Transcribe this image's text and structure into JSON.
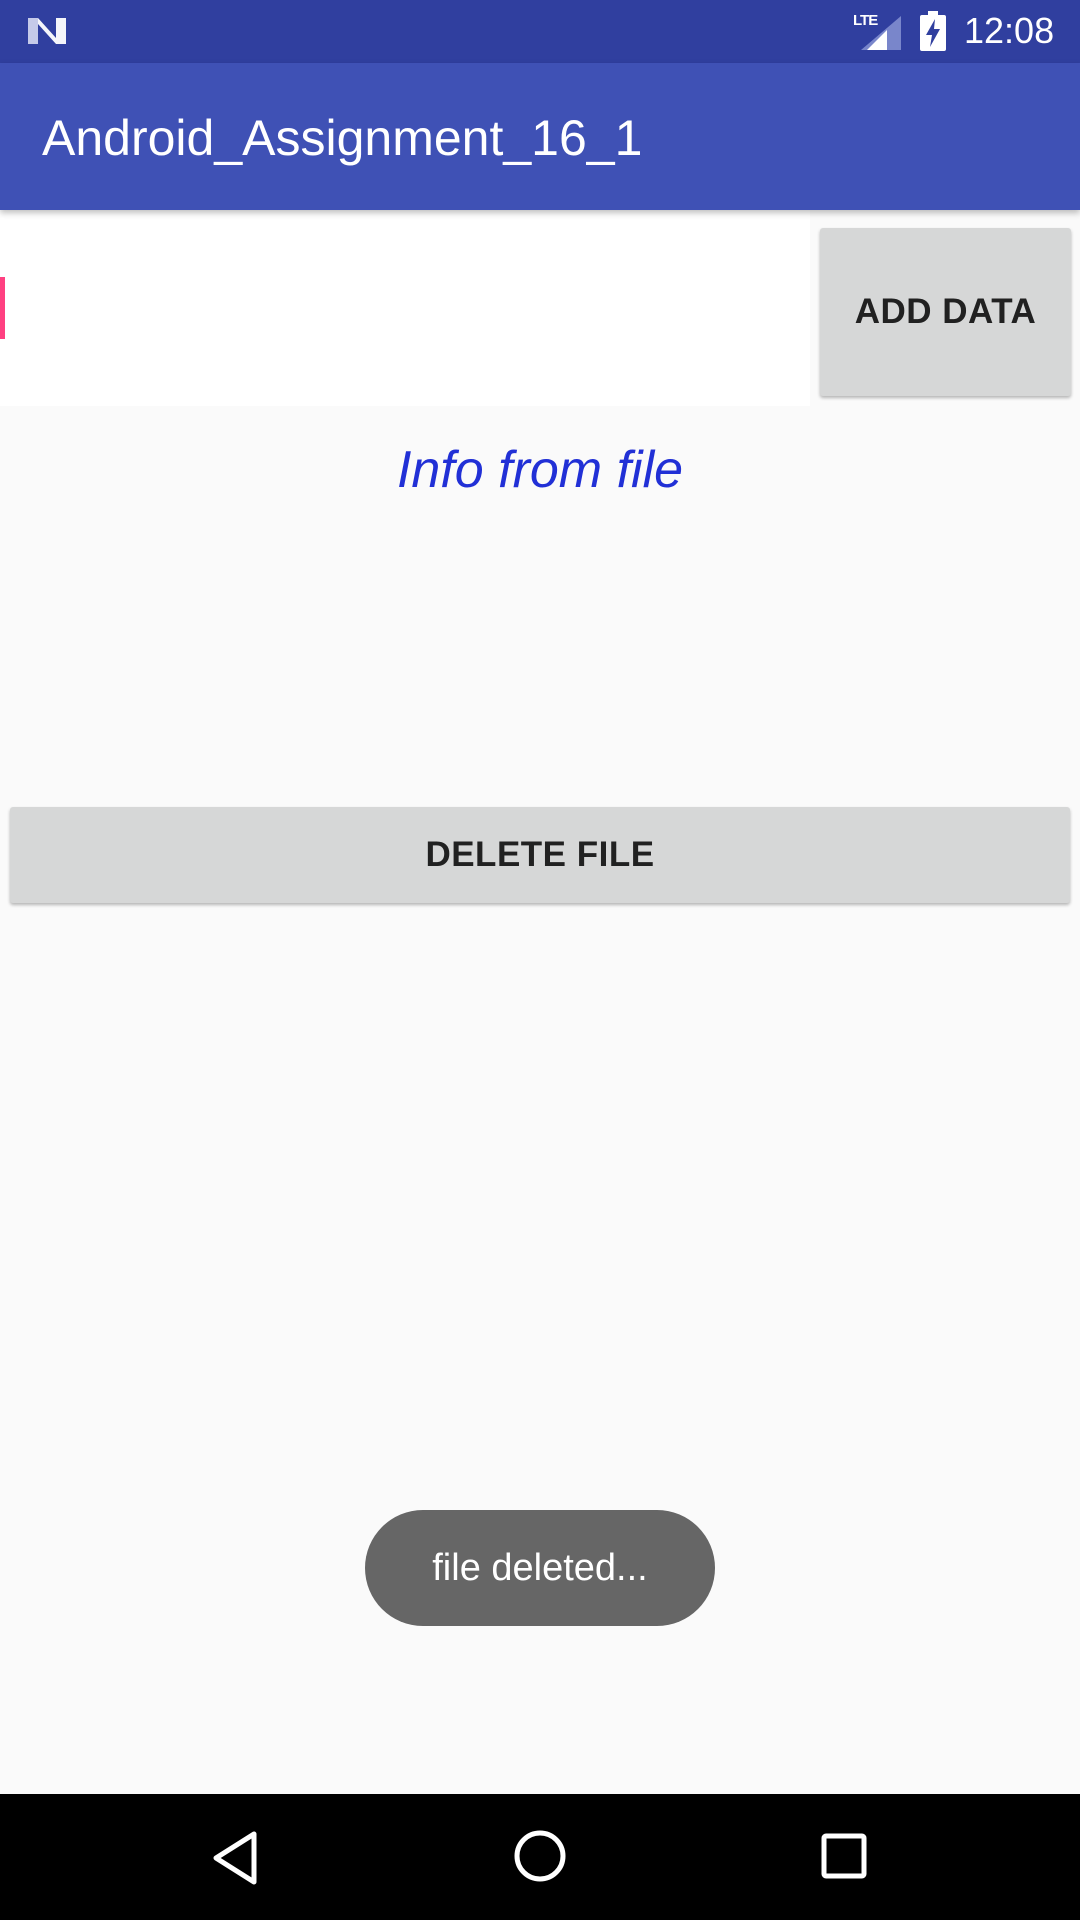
{
  "status_bar": {
    "network_label": "LTE",
    "time": "12:08",
    "icons": [
      "android-n-icon",
      "lte-signal-icon",
      "battery-charging-icon"
    ]
  },
  "app_bar": {
    "title": "Android_Assignment_16_1"
  },
  "input": {
    "value": "",
    "placeholder": ""
  },
  "buttons": {
    "add_data": "ADD DATA",
    "delete_file": "DELETE FILE"
  },
  "info": {
    "text": "Info from file"
  },
  "toast": {
    "message": "file deleted..."
  },
  "nav_bar": {
    "icons": [
      "back-icon",
      "home-icon",
      "recents-icon"
    ]
  },
  "colors": {
    "status_bar": "#303f9f",
    "app_bar": "#3f51b5",
    "accent": "#ff4081",
    "info_text": "#2130d6",
    "button_bg": "#d6d7d7",
    "toast_bg": "#666666"
  }
}
